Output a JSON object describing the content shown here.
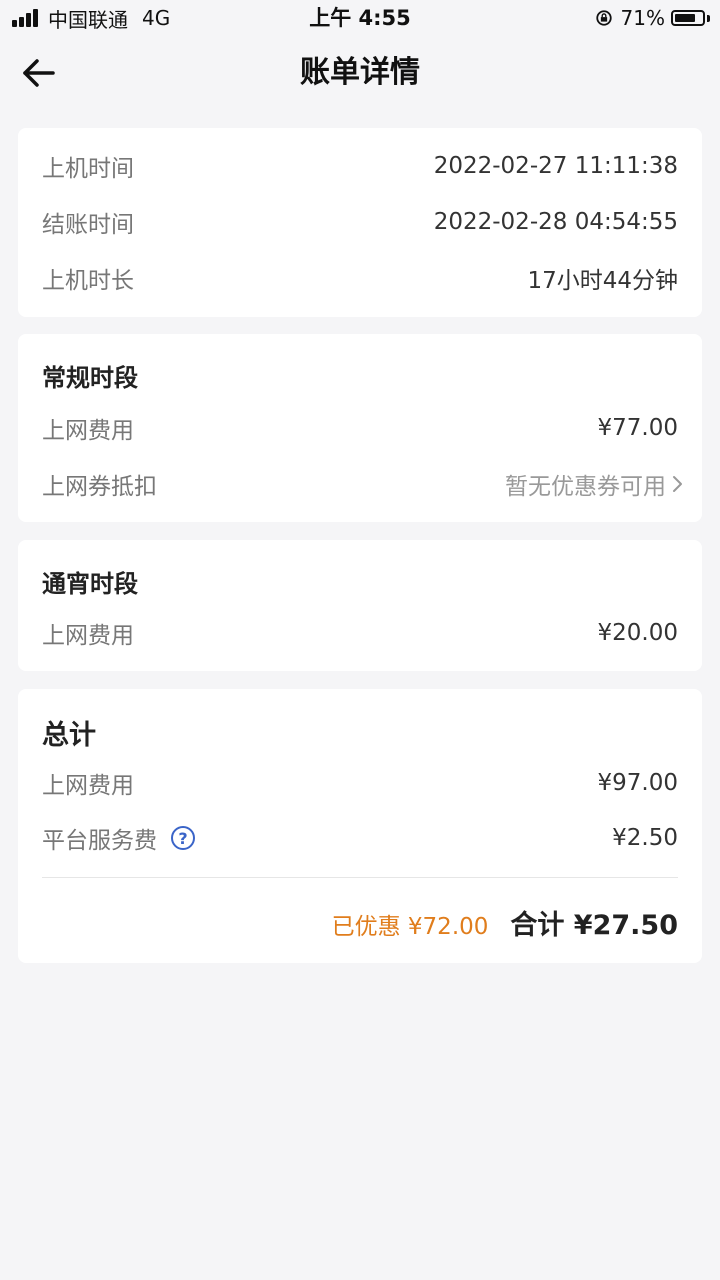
{
  "status_bar": {
    "carrier": "中国联通",
    "network": "4G",
    "time": "上午 4:55",
    "battery_percent": "71%"
  },
  "nav": {
    "title": "账单详情"
  },
  "session": {
    "start_label": "上机时间",
    "start_value": "2022-02-27 11:11:38",
    "end_label": "结账时间",
    "end_value": "2022-02-28 04:54:55",
    "duration_label": "上机时长",
    "duration_value": "17小时44分钟"
  },
  "regular": {
    "title": "常规时段",
    "fee_label": "上网费用",
    "fee_value": "¥77.00",
    "coupon_label": "上网券抵扣",
    "coupon_value": "暂无优惠券可用"
  },
  "overnight": {
    "title": "通宵时段",
    "fee_label": "上网费用",
    "fee_value": "¥20.00"
  },
  "summary": {
    "title": "总计",
    "fee_label": "上网费用",
    "fee_value": "¥97.00",
    "service_label": "平台服务费",
    "service_value": "¥2.50",
    "discount_text": "已优惠 ¥72.00",
    "total_text": "合计 ¥27.50",
    "discount_color": "#e07d1c"
  }
}
